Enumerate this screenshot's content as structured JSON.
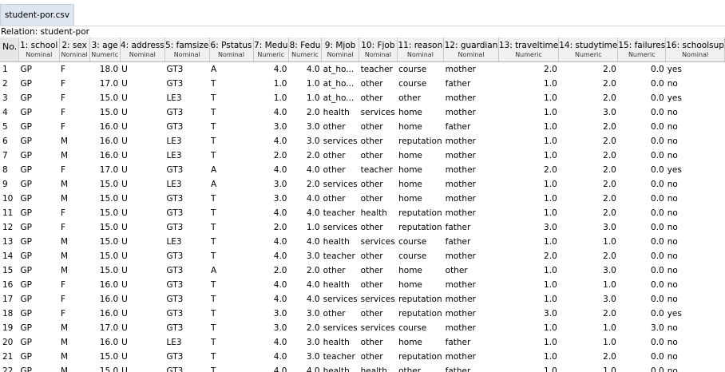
{
  "tab": {
    "label": "student-por.csv"
  },
  "relation": {
    "label": "Relation: student-por"
  },
  "table": {
    "columns": [
      {
        "name": "No.",
        "type": "",
        "align": "left",
        "width": 26
      },
      {
        "name": "1: school",
        "type": "Nominal",
        "align": "left",
        "width": 54
      },
      {
        "name": "2: sex",
        "type": "Nominal",
        "align": "left",
        "width": 44
      },
      {
        "name": "3: age",
        "type": "Numeric",
        "align": "right",
        "width": 43
      },
      {
        "name": "4: address",
        "type": "Nominal",
        "align": "left",
        "width": 57
      },
      {
        "name": "5: famsize",
        "type": "Nominal",
        "align": "left",
        "width": 56
      },
      {
        "name": "6: Pstatus",
        "type": "Nominal",
        "align": "left",
        "width": 58
      },
      {
        "name": "7: Medu",
        "type": "Numeric",
        "align": "right",
        "width": 46
      },
      {
        "name": "8: Fedu",
        "type": "Numeric",
        "align": "right",
        "width": 43
      },
      {
        "name": "9: Mjob",
        "type": "Nominal",
        "align": "left",
        "width": 46
      },
      {
        "name": "10: Fjob",
        "type": "Nominal",
        "align": "left",
        "width": 48
      },
      {
        "name": "11: reason",
        "type": "Nominal",
        "align": "left",
        "width": 56
      },
      {
        "name": "12: guardian",
        "type": "Nominal",
        "align": "left",
        "width": 70
      },
      {
        "name": "13: traveltime",
        "type": "Numeric",
        "align": "right",
        "width": 74
      },
      {
        "name": "14: studytime",
        "type": "Numeric",
        "align": "right",
        "width": 73
      },
      {
        "name": "15: failures",
        "type": "Numeric",
        "align": "right",
        "width": 59
      },
      {
        "name": "16: schoolsup",
        "type": "Nominal",
        "align": "left",
        "width": 55
      }
    ],
    "rows": [
      [
        "1",
        "GP",
        "F",
        "18.0",
        "U",
        "GT3",
        "A",
        "4.0",
        "4.0",
        "at_ho...",
        "teacher",
        "course",
        "mother",
        "2.0",
        "2.0",
        "0.0",
        "yes"
      ],
      [
        "2",
        "GP",
        "F",
        "17.0",
        "U",
        "GT3",
        "T",
        "1.0",
        "1.0",
        "at_ho...",
        "other",
        "course",
        "father",
        "1.0",
        "2.0",
        "0.0",
        "no"
      ],
      [
        "3",
        "GP",
        "F",
        "15.0",
        "U",
        "LE3",
        "T",
        "1.0",
        "1.0",
        "at_ho...",
        "other",
        "other",
        "mother",
        "1.0",
        "2.0",
        "0.0",
        "yes"
      ],
      [
        "4",
        "GP",
        "F",
        "15.0",
        "U",
        "GT3",
        "T",
        "4.0",
        "2.0",
        "health",
        "services",
        "home",
        "mother",
        "1.0",
        "3.0",
        "0.0",
        "no"
      ],
      [
        "5",
        "GP",
        "F",
        "16.0",
        "U",
        "GT3",
        "T",
        "3.0",
        "3.0",
        "other",
        "other",
        "home",
        "father",
        "1.0",
        "2.0",
        "0.0",
        "no"
      ],
      [
        "6",
        "GP",
        "M",
        "16.0",
        "U",
        "LE3",
        "T",
        "4.0",
        "3.0",
        "services",
        "other",
        "reputation",
        "mother",
        "1.0",
        "2.0",
        "0.0",
        "no"
      ],
      [
        "7",
        "GP",
        "M",
        "16.0",
        "U",
        "LE3",
        "T",
        "2.0",
        "2.0",
        "other",
        "other",
        "home",
        "mother",
        "1.0",
        "2.0",
        "0.0",
        "no"
      ],
      [
        "8",
        "GP",
        "F",
        "17.0",
        "U",
        "GT3",
        "A",
        "4.0",
        "4.0",
        "other",
        "teacher",
        "home",
        "mother",
        "2.0",
        "2.0",
        "0.0",
        "yes"
      ],
      [
        "9",
        "GP",
        "M",
        "15.0",
        "U",
        "LE3",
        "A",
        "3.0",
        "2.0",
        "services",
        "other",
        "home",
        "mother",
        "1.0",
        "2.0",
        "0.0",
        "no"
      ],
      [
        "10",
        "GP",
        "M",
        "15.0",
        "U",
        "GT3",
        "T",
        "3.0",
        "4.0",
        "other",
        "other",
        "home",
        "mother",
        "1.0",
        "2.0",
        "0.0",
        "no"
      ],
      [
        "11",
        "GP",
        "F",
        "15.0",
        "U",
        "GT3",
        "T",
        "4.0",
        "4.0",
        "teacher",
        "health",
        "reputation",
        "mother",
        "1.0",
        "2.0",
        "0.0",
        "no"
      ],
      [
        "12",
        "GP",
        "F",
        "15.0",
        "U",
        "GT3",
        "T",
        "2.0",
        "1.0",
        "services",
        "other",
        "reputation",
        "father",
        "3.0",
        "3.0",
        "0.0",
        "no"
      ],
      [
        "13",
        "GP",
        "M",
        "15.0",
        "U",
        "LE3",
        "T",
        "4.0",
        "4.0",
        "health",
        "services",
        "course",
        "father",
        "1.0",
        "1.0",
        "0.0",
        "no"
      ],
      [
        "14",
        "GP",
        "M",
        "15.0",
        "U",
        "GT3",
        "T",
        "4.0",
        "3.0",
        "teacher",
        "other",
        "course",
        "mother",
        "2.0",
        "2.0",
        "0.0",
        "no"
      ],
      [
        "15",
        "GP",
        "M",
        "15.0",
        "U",
        "GT3",
        "A",
        "2.0",
        "2.0",
        "other",
        "other",
        "home",
        "other",
        "1.0",
        "3.0",
        "0.0",
        "no"
      ],
      [
        "16",
        "GP",
        "F",
        "16.0",
        "U",
        "GT3",
        "T",
        "4.0",
        "4.0",
        "health",
        "other",
        "home",
        "mother",
        "1.0",
        "1.0",
        "0.0",
        "no"
      ],
      [
        "17",
        "GP",
        "F",
        "16.0",
        "U",
        "GT3",
        "T",
        "4.0",
        "4.0",
        "services",
        "services",
        "reputation",
        "mother",
        "1.0",
        "3.0",
        "0.0",
        "no"
      ],
      [
        "18",
        "GP",
        "F",
        "16.0",
        "U",
        "GT3",
        "T",
        "3.0",
        "3.0",
        "other",
        "other",
        "reputation",
        "mother",
        "3.0",
        "2.0",
        "0.0",
        "yes"
      ],
      [
        "19",
        "GP",
        "M",
        "17.0",
        "U",
        "GT3",
        "T",
        "3.0",
        "2.0",
        "services",
        "services",
        "course",
        "mother",
        "1.0",
        "1.0",
        "3.0",
        "no"
      ],
      [
        "20",
        "GP",
        "M",
        "16.0",
        "U",
        "LE3",
        "T",
        "4.0",
        "3.0",
        "health",
        "other",
        "home",
        "father",
        "1.0",
        "1.0",
        "0.0",
        "no"
      ],
      [
        "21",
        "GP",
        "M",
        "15.0",
        "U",
        "GT3",
        "T",
        "4.0",
        "3.0",
        "teacher",
        "other",
        "reputation",
        "mother",
        "1.0",
        "2.0",
        "0.0",
        "no"
      ],
      [
        "22",
        "GP",
        "M",
        "15.0",
        "U",
        "GT3",
        "T",
        "4.0",
        "4.0",
        "health",
        "health",
        "other",
        "father",
        "1.0",
        "1.0",
        "0.0",
        "no"
      ]
    ]
  }
}
